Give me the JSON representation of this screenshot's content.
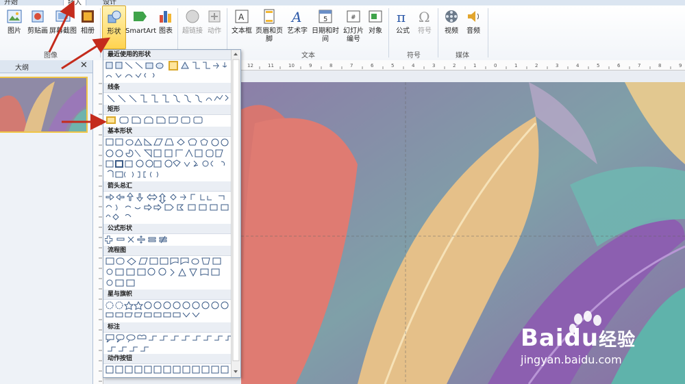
{
  "tabs": [
    "开始",
    "插入",
    "设计"
  ],
  "ribbon": {
    "buttons": [
      {
        "key": "picture",
        "label": "图片"
      },
      {
        "key": "clipart",
        "label": "剪贴画"
      },
      {
        "key": "screenshot",
        "label": "屏幕截图"
      },
      {
        "key": "album",
        "label": "相册"
      },
      {
        "key": "shapes",
        "label": "形状"
      },
      {
        "key": "smartart",
        "label": "SmartArt"
      },
      {
        "key": "chart",
        "label": "图表"
      },
      {
        "key": "hyperlink",
        "label": "超链接"
      },
      {
        "key": "action",
        "label": "动作"
      },
      {
        "key": "textbox",
        "label": "文本框"
      },
      {
        "key": "headerfooter",
        "label": "页眉和页脚"
      },
      {
        "key": "wordart",
        "label": "艺术字"
      },
      {
        "key": "datetime",
        "label": "日期和时间"
      },
      {
        "key": "slidenum",
        "label": "幻灯片\n编号"
      },
      {
        "key": "object",
        "label": "对象"
      },
      {
        "key": "equation",
        "label": "公式"
      },
      {
        "key": "symbol",
        "label": "符号"
      },
      {
        "key": "video",
        "label": "视频"
      },
      {
        "key": "audio",
        "label": "音频"
      }
    ],
    "groups": {
      "images": "图像",
      "text": "文本",
      "symbols": "符号",
      "media": "媒体"
    }
  },
  "pane": {
    "outline_tab": "大纲",
    "close": "✕"
  },
  "dropdown": {
    "categories": [
      "最近使用的形状",
      "线条",
      "矩形",
      "基本形状",
      "箭头总汇",
      "公式形状",
      "流程图",
      "星与旗帜",
      "标注",
      "动作按钮"
    ]
  },
  "ruler": {
    "h_ticks": [
      "12",
      "11",
      "10",
      "9",
      "8",
      "7",
      "6",
      "5",
      "4",
      "3",
      "2",
      "1",
      "0",
      "1",
      "2",
      "3",
      "4",
      "5",
      "6",
      "7",
      "8",
      "9",
      "10",
      "11",
      "12"
    ]
  },
  "watermark": {
    "brand": "Bai",
    "brand2": "du",
    "cn": "经验",
    "url": "jingyan.baidu.com"
  },
  "colors": {
    "accent": "#c42b1c",
    "selected": "#ffd34f",
    "ribbon_bg": "#f2f5f9"
  }
}
